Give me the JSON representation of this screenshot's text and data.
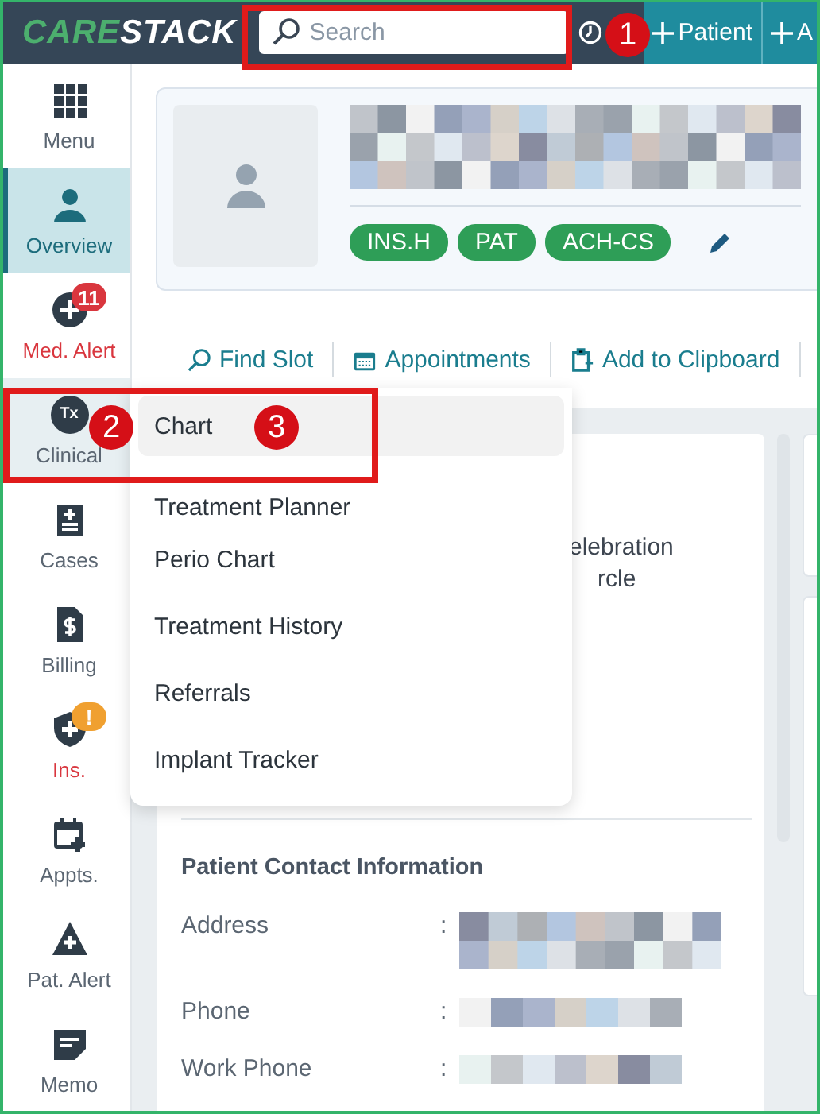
{
  "header": {
    "logo_primary": "CARE",
    "logo_secondary": "STACK",
    "search": {
      "placeholder": "Search"
    },
    "buttons": [
      {
        "label": "Patient"
      },
      {
        "label": "A"
      }
    ]
  },
  "sidebar": {
    "items": [
      {
        "label": "Menu",
        "kind": "grid",
        "selected": false,
        "open": false,
        "alert": false
      },
      {
        "label": "Overview",
        "kind": "person",
        "selected": true,
        "open": false,
        "alert": false
      },
      {
        "label": "Med. Alert",
        "kind": "medical",
        "selected": false,
        "open": false,
        "alert": true,
        "badge": {
          "text": "11",
          "color": "#d9363e"
        }
      },
      {
        "label": "Clinical",
        "kind": "tx",
        "selected": false,
        "open": true,
        "alert": false,
        "icon_text": "Tx"
      },
      {
        "label": "Cases",
        "kind": "clipboard",
        "selected": false,
        "open": false,
        "alert": false
      },
      {
        "label": "Billing",
        "kind": "bill",
        "selected": false,
        "open": false,
        "alert": false
      },
      {
        "label": "Ins.",
        "kind": "shield",
        "selected": false,
        "open": false,
        "alert": true,
        "badge": {
          "text": "!",
          "color": "#f0a030"
        }
      },
      {
        "label": "Appts.",
        "kind": "calendar",
        "selected": false,
        "open": false,
        "alert": false
      },
      {
        "label": "Pat. Alert",
        "kind": "warning",
        "selected": false,
        "open": false,
        "alert": false
      },
      {
        "label": "Memo",
        "kind": "memo",
        "selected": false,
        "open": false,
        "alert": false
      }
    ]
  },
  "patient_card": {
    "tags": [
      "INS.H",
      "PAT",
      "ACH-CS"
    ]
  },
  "actions": [
    {
      "label": "Find Slot",
      "kind": "search"
    },
    {
      "label": "Appointments",
      "kind": "calendar"
    },
    {
      "label": "Add to Clipboard",
      "kind": "clipboard"
    }
  ],
  "clinical_menu": {
    "items": [
      {
        "label": "Chart",
        "selected": true
      },
      {
        "label": "Treatment Planner",
        "selected": false
      },
      {
        "label": "Perio Chart",
        "selected": false
      },
      {
        "label": "Treatment History",
        "selected": false
      },
      {
        "label": "Referrals",
        "selected": false
      },
      {
        "label": "Implant Tracker",
        "selected": false
      }
    ]
  },
  "details": {
    "fragments": [
      "elebration",
      "rcle"
    ],
    "section_title": "Patient Contact Information",
    "rows": [
      {
        "label": "Address",
        "separator": ":",
        "kind": "multiline"
      },
      {
        "label": "Phone",
        "separator": ":",
        "kind": "single"
      },
      {
        "label": "Work Phone",
        "separator": ":",
        "kind": "single"
      }
    ]
  },
  "annotations": [
    {
      "number": "1"
    },
    {
      "number": "2"
    },
    {
      "number": "3"
    }
  ]
}
